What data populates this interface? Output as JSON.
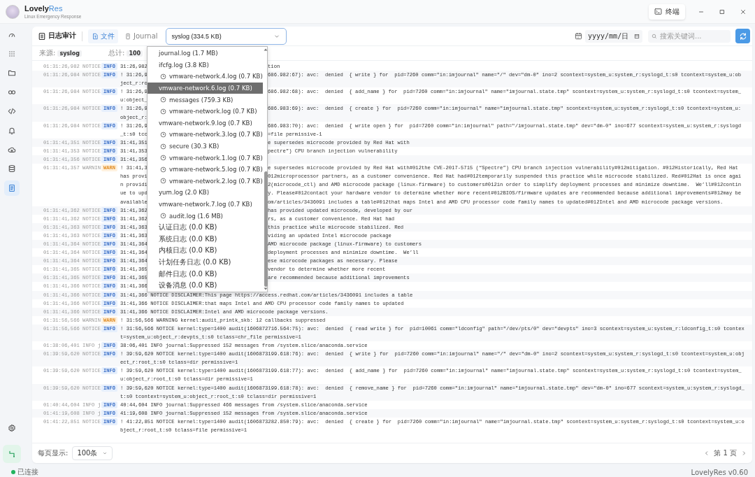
{
  "app": {
    "name": "Lovely",
    "name_accent": "Res",
    "subtitle": "Linux Emergency Response"
  },
  "terminal_button": {
    "label": "终端"
  },
  "sidebar": {
    "items": [
      {
        "selected": false
      },
      {
        "selected": false
      },
      {
        "selected": false
      },
      {
        "selected": false
      },
      {
        "selected": false
      },
      {
        "selected": false
      },
      {
        "selected": false
      },
      {
        "selected": false
      },
      {
        "selected": true
      }
    ]
  },
  "toolbar": {
    "title": "日志审计",
    "tabs": [
      {
        "label": "文件",
        "selected": true
      },
      {
        "label": "Journal",
        "selected": false
      }
    ],
    "file_select": {
      "value": "syslog (334.5 KB)"
    },
    "date_field": {
      "placeholder": "yyyy/mm/日"
    },
    "search": {
      "placeholder": "搜索关键词..."
    }
  },
  "summary": {
    "source_label": "来源:",
    "source": "syslog",
    "total_label": "总计:",
    "total": "100"
  },
  "dropdown": {
    "options": [
      {
        "label": "journal.log (1.7 MB)",
        "kind": "plain",
        "selected": false
      },
      {
        "label": "ifcfg.log (3.8 KB)",
        "kind": "plain",
        "selected": false
      },
      {
        "label": "vmware-network.4.log (0.7 KB)",
        "kind": "clock",
        "selected": false
      },
      {
        "label": "vmware-network.6.log (0.7 KB)",
        "kind": "plain",
        "selected": true
      },
      {
        "label": "messages (759.3 KB)",
        "kind": "clock",
        "selected": false
      },
      {
        "label": "vmware-network.log (0.7 KB)",
        "kind": "clock",
        "selected": false
      },
      {
        "label": "vmware-network.9.log (0.7 KB)",
        "kind": "plain",
        "selected": false
      },
      {
        "label": "vmware-network.3.log (0.7 KB)",
        "kind": "clock",
        "selected": false
      },
      {
        "label": "secure (30.3 KB)",
        "kind": "clock",
        "selected": false
      },
      {
        "label": "vmware-network.1.log (0.7 KB)",
        "kind": "clock",
        "selected": false
      },
      {
        "label": "vmware-network.5.log (0.7 KB)",
        "kind": "clock",
        "selected": false
      },
      {
        "label": "vmware-network.2.log (0.7 KB)",
        "kind": "clock",
        "selected": false
      },
      {
        "label": "yum.log (2.0 KB)",
        "kind": "plain",
        "selected": false
      },
      {
        "label": "vmware-network.7.log (0.7 KB)",
        "kind": "plain",
        "selected": false
      },
      {
        "label": "audit.log (1.6 MB)",
        "kind": "clock",
        "selected": false
      },
      {
        "label": "认证日志 (0.0 KB)",
        "kind": "plain",
        "selected": false
      },
      {
        "label": "系统日志 (0.0 KB)",
        "kind": "plain",
        "selected": false
      },
      {
        "label": "内核日志 (0.0 KB)",
        "kind": "plain",
        "selected": false
      },
      {
        "label": "计划任务日志 (0.0 KB)",
        "kind": "plain",
        "selected": false
      },
      {
        "label": "邮件日志 (0.0 KB)",
        "kind": "plain",
        "selected": false
      },
      {
        "label": "设备消息 (0.0 KB)",
        "kind": "plain",
        "selected": false
      }
    ]
  },
  "log": {
    "rows": [
      {
        "time": "01:31:26,982 NOTICE",
        "level": "INFO",
        "kind": "info",
        "head": [
          "31:26,982"
        ],
        "tail": [
          "tion"
        ]
      },
      {
        "time": "01:31:26,984 NOTICE",
        "level": "INFO",
        "kind": "info",
        "head": [
          "! 31:26,9",
          "ject_r:ro"
        ],
        "tail": [
          "686.982:67): avc:  denied  { write } for  pid=7260 comm=\"in:imjournal\" name=\"/\" dev=\"dm-0\" ino=2 scontext=system_u:system_r:syslogd_t:s0 tcontext=system_u:ob"
        ]
      },
      {
        "time": "01:31:26,984 NOTICE",
        "level": "INFO",
        "kind": "info",
        "head": [
          "! 31:26,9",
          "u:object_"
        ],
        "tail": [
          "686.982:68): avc:  denied  { add_name } for  pid=7260 comm=\"in:imjournal\" name=\"imjournal.state.tmp\" scontext=system_u:system_r:syslogd_t:s0 tcontext=system_"
        ]
      },
      {
        "time": "01:31:26,984 NOTICE",
        "level": "INFO",
        "kind": "info",
        "head": [
          "! 31:26,9",
          "object_r:"
        ],
        "tail": [
          "686.983:69): avc:  denied  { create } for  pid=7260 comm=\"in:imjournal\" name=\"imjournal.state.tmp\" scontext=system_u:system_r:syslogd_t:s0 tcontext=system_u:"
        ]
      },
      {
        "time": "01:31:26,984 NOTICE",
        "level": "INFO",
        "kind": "info",
        "head": [
          "! 31:26,9",
          "_t:s0 tcc"
        ],
        "tail": [
          "686.983:70): avc:  denied  { write open } for  pid=7260 comm=\"in:imjournal\" path=\"/imjournal.state.tmp\" dev=\"dm-0\" ino=677 scontext=system_u:system_r:syslogd",
          "=file permissive-1"
        ]
      },
      {
        "time": "01:31:41,351 NOTICE",
        "level": "INFO",
        "kind": "info",
        "head": [
          "31:41,351"
        ],
        "tail": [
          "e supersedes microcode provided by Red Hat with"
        ]
      },
      {
        "time": "01:31:41,353 NOTICE",
        "level": "INFO",
        "kind": "info",
        "head": [
          "31:41,353"
        ],
        "tail": [
          "pectre”) CPU branch injection vulnerability"
        ]
      },
      {
        "time": "01:31:41,356 NOTICE",
        "level": "INFO",
        "kind": "info",
        "head": [
          "31:41,356"
        ],
        "tail": []
      },
      {
        "time": "01:31:41,357 WARNIN",
        "level": "WARN",
        "kind": "warn",
        "head": [
          "! 31:41,3",
          "has provi",
          "n providi",
          "ue to upd",
          "available"
        ],
        "tail": [
          "e supersedes microcode provided by Red Hat with#012the CVE-2017-5715 (“Spectre”) CPU branch injection vulnerability#012mitigation. #012Historically, Red Hat",
          "012microprocessor partners, as a customer convenience. Red Hat had#012temporarily suspended this practice while microcode stabilized. Red#012Hat is once agai",
          "2(microcode_ctl) and AMD microcode package (linux-firmware) to customers#012in order to simplify deployment processes and minimize downtime.  We’ll#012contin",
          "y. Please#012contact your hardware vendor to determine whether more recent#012BIOS/firmware updates are recommended because additional improvements#012may be",
          "om/articles/3436091 includes a table#012that maps Intel and AMD CPU processor code family names to updated#012Intel and AMD microcode package versions."
        ]
      },
      {
        "time": "01:31:41,362 NOTICE",
        "level": "INFO",
        "kind": "info",
        "head": [
          "31:41,362"
        ],
        "tail": [
          "has provided updated microcode, developed by our"
        ]
      },
      {
        "time": "01:31:41,362 NOTICE",
        "level": "INFO",
        "kind": "info",
        "head": [
          "31:41,362"
        ],
        "tail": [
          "rs, as a customer convenience. Red Hat had"
        ]
      },
      {
        "time": "01:31:41,363 NOTICE",
        "level": "INFO",
        "kind": "info",
        "head": [
          "31:41,363"
        ],
        "tail": [
          "this practice while microcode stabilized. Red"
        ]
      },
      {
        "time": "01:31:41,363 NOTICE",
        "level": "INFO",
        "kind": "info",
        "head": [
          "31:41,363"
        ],
        "tail": [
          "viding an updated Intel microcode package"
        ]
      },
      {
        "time": "01:31:41,364 NOTICE",
        "level": "INFO",
        "kind": "info",
        "head": [
          "31:41,364"
        ],
        "tail": [
          "AMD microcode package (linux-firmware) to customers"
        ]
      },
      {
        "time": "01:31:41,364 NOTICE",
        "level": "INFO",
        "kind": "info",
        "head": [
          "31:41,364"
        ],
        "tail": [
          "deployment processes and minimize downtime.  We’ll"
        ]
      },
      {
        "time": "01:31:41,364 NOTICE",
        "level": "INFO",
        "kind": "info",
        "head": [
          "31:41,364"
        ],
        "tail": [
          "ese microcode packages as necessary. Please"
        ]
      },
      {
        "time": "01:31:41,365 NOTICE",
        "level": "INFO",
        "kind": "info",
        "head": [
          "31:41,365"
        ],
        "tail": [
          "vendor to determine whether more recent"
        ]
      },
      {
        "time": "01:31:41,365 NOTICE",
        "level": "INFO",
        "kind": "info",
        "head": [
          "31:41,365"
        ],
        "tail": [
          "are recommended because additional improvements"
        ]
      },
      {
        "time": "01:31:41,366 NOTICE",
        "level": "INFO",
        "kind": "info",
        "head": [
          "31:41,366"
        ],
        "tail": []
      },
      {
        "time": "01:31:41,366 NOTICE",
        "level": "INFO",
        "kind": "info",
        "message": "31:41,366 NOTICE DISCLAIMER:This page https://access.redhat.com/articles/3436091 includes a table"
      },
      {
        "time": "01:31:41,366 NOTICE",
        "level": "INFO",
        "kind": "info",
        "message": "31:41,366 NOTICE DISCLAIMER:that maps Intel and AMD CPU processor code family names to updated"
      },
      {
        "time": "01:31:41,366 NOTICE",
        "level": "INFO",
        "kind": "info",
        "message": "31:41,366 NOTICE DISCLAIMER:Intel and AMD microcode package versions."
      },
      {
        "time": "01:31:56,566 WARNIN",
        "level": "WARN",
        "kind": "warn",
        "message": "! 31:56,566 WARNING kernel:audit_printk_skb: 12 callbacks suppressed"
      },
      {
        "time": "01:31:56,566 NOTICE",
        "level": "INFO",
        "kind": "info",
        "message": "! 31:56,566 NOTICE kernel:type=1400 audit(1606872716.564:75): avc:  denied  { read write } for  pid=10061 comm=\"ldconfig\" path=\"/dev/pts/0\" dev=\"devpts\" ino=3 scontext=system_u:system_r:ldconfig_t:s0 tcontext=system_u:object_r:devpts_t:s0 tclass=chr_file permissive=1"
      },
      {
        "time": "01:38:06,401 INFO j",
        "level": "INFO",
        "kind": "info",
        "message": "38:06,401 INFO journal:Suppressed 152 messages from /system.slice/anaconda.service"
      },
      {
        "time": "01:39:59,620 NOTICE",
        "level": "INFO",
        "kind": "info",
        "message": "! 39:59,620 NOTICE kernel:type=1400 audit(1606873199.618:76): avc:  denied  { write } for  pid=7260 comm=\"in:imjournal\" name=\"/\" dev=\"dm-0\" ino=2 scontext=system_u:system_r:syslogd_t:s0 tcontext=system_u:object_r:root_t:s0 tclass=dir permissive=1"
      },
      {
        "time": "01:39:59,620 NOTICE",
        "level": "INFO",
        "kind": "info",
        "message": "! 39:59,620 NOTICE kernel:type=1400 audit(1606873199.618:77): avc:  denied  { add_name } for  pid=7260 comm=\"in:imjournal\" name=\"imjournal.state.tmp\" scontext=system_u:system_r:syslogd_t:s0 tcontext=system_u:object_r:root_t:s0 tclass=dir permissive=1"
      },
      {
        "time": "01:39:59,620 NOTICE",
        "level": "INFO",
        "kind": "info",
        "message": "! 39:59,620 NOTICE kernel:type=1400 audit(1606873199.618:78): avc:  denied  { remove_name } for  pid=7260 comm=\"in:imjournal\" name=\"imjournal.state.tmp\" dev=\"dm-0\" ino=677 scontext=system_u:system_r:syslogd_t:s0 tcontext=system_u:object_r:root_t:s0 tclass=dir permissive=1"
      },
      {
        "time": "01:40:44,604 INFO j",
        "level": "INFO",
        "kind": "info",
        "message": "40:44,604 INFO journal:Suppressed 466 messages from /system.slice/anaconda.service"
      },
      {
        "time": "01:41:19,608 INFO j",
        "level": "INFO",
        "kind": "info",
        "message": "41:19,608 INFO journal:Suppressed 152 messages from /system.slice/anaconda.service"
      },
      {
        "time": "01:41:22,851 NOTICE",
        "level": "INFO",
        "kind": "info",
        "message": "! 41:22,851 NOTICE kernel:type=1400 audit(1606873282.850:79): avc:  denied  { create } for  pid=7260 comm=\"in:imjournal\" name=\"imjournal.state.tmp\" scontext=system_u:system_r:syslogd_t:s0 tcontext=system_u:object_r:root_t:s0 tclass=file permissive=1"
      }
    ]
  },
  "footer": {
    "page_size_label": "每页显示:",
    "page_size": "100条",
    "page": "第 1 页"
  },
  "status_bar": {
    "connection": "已连接",
    "version": "LovelyRes v0.60"
  }
}
